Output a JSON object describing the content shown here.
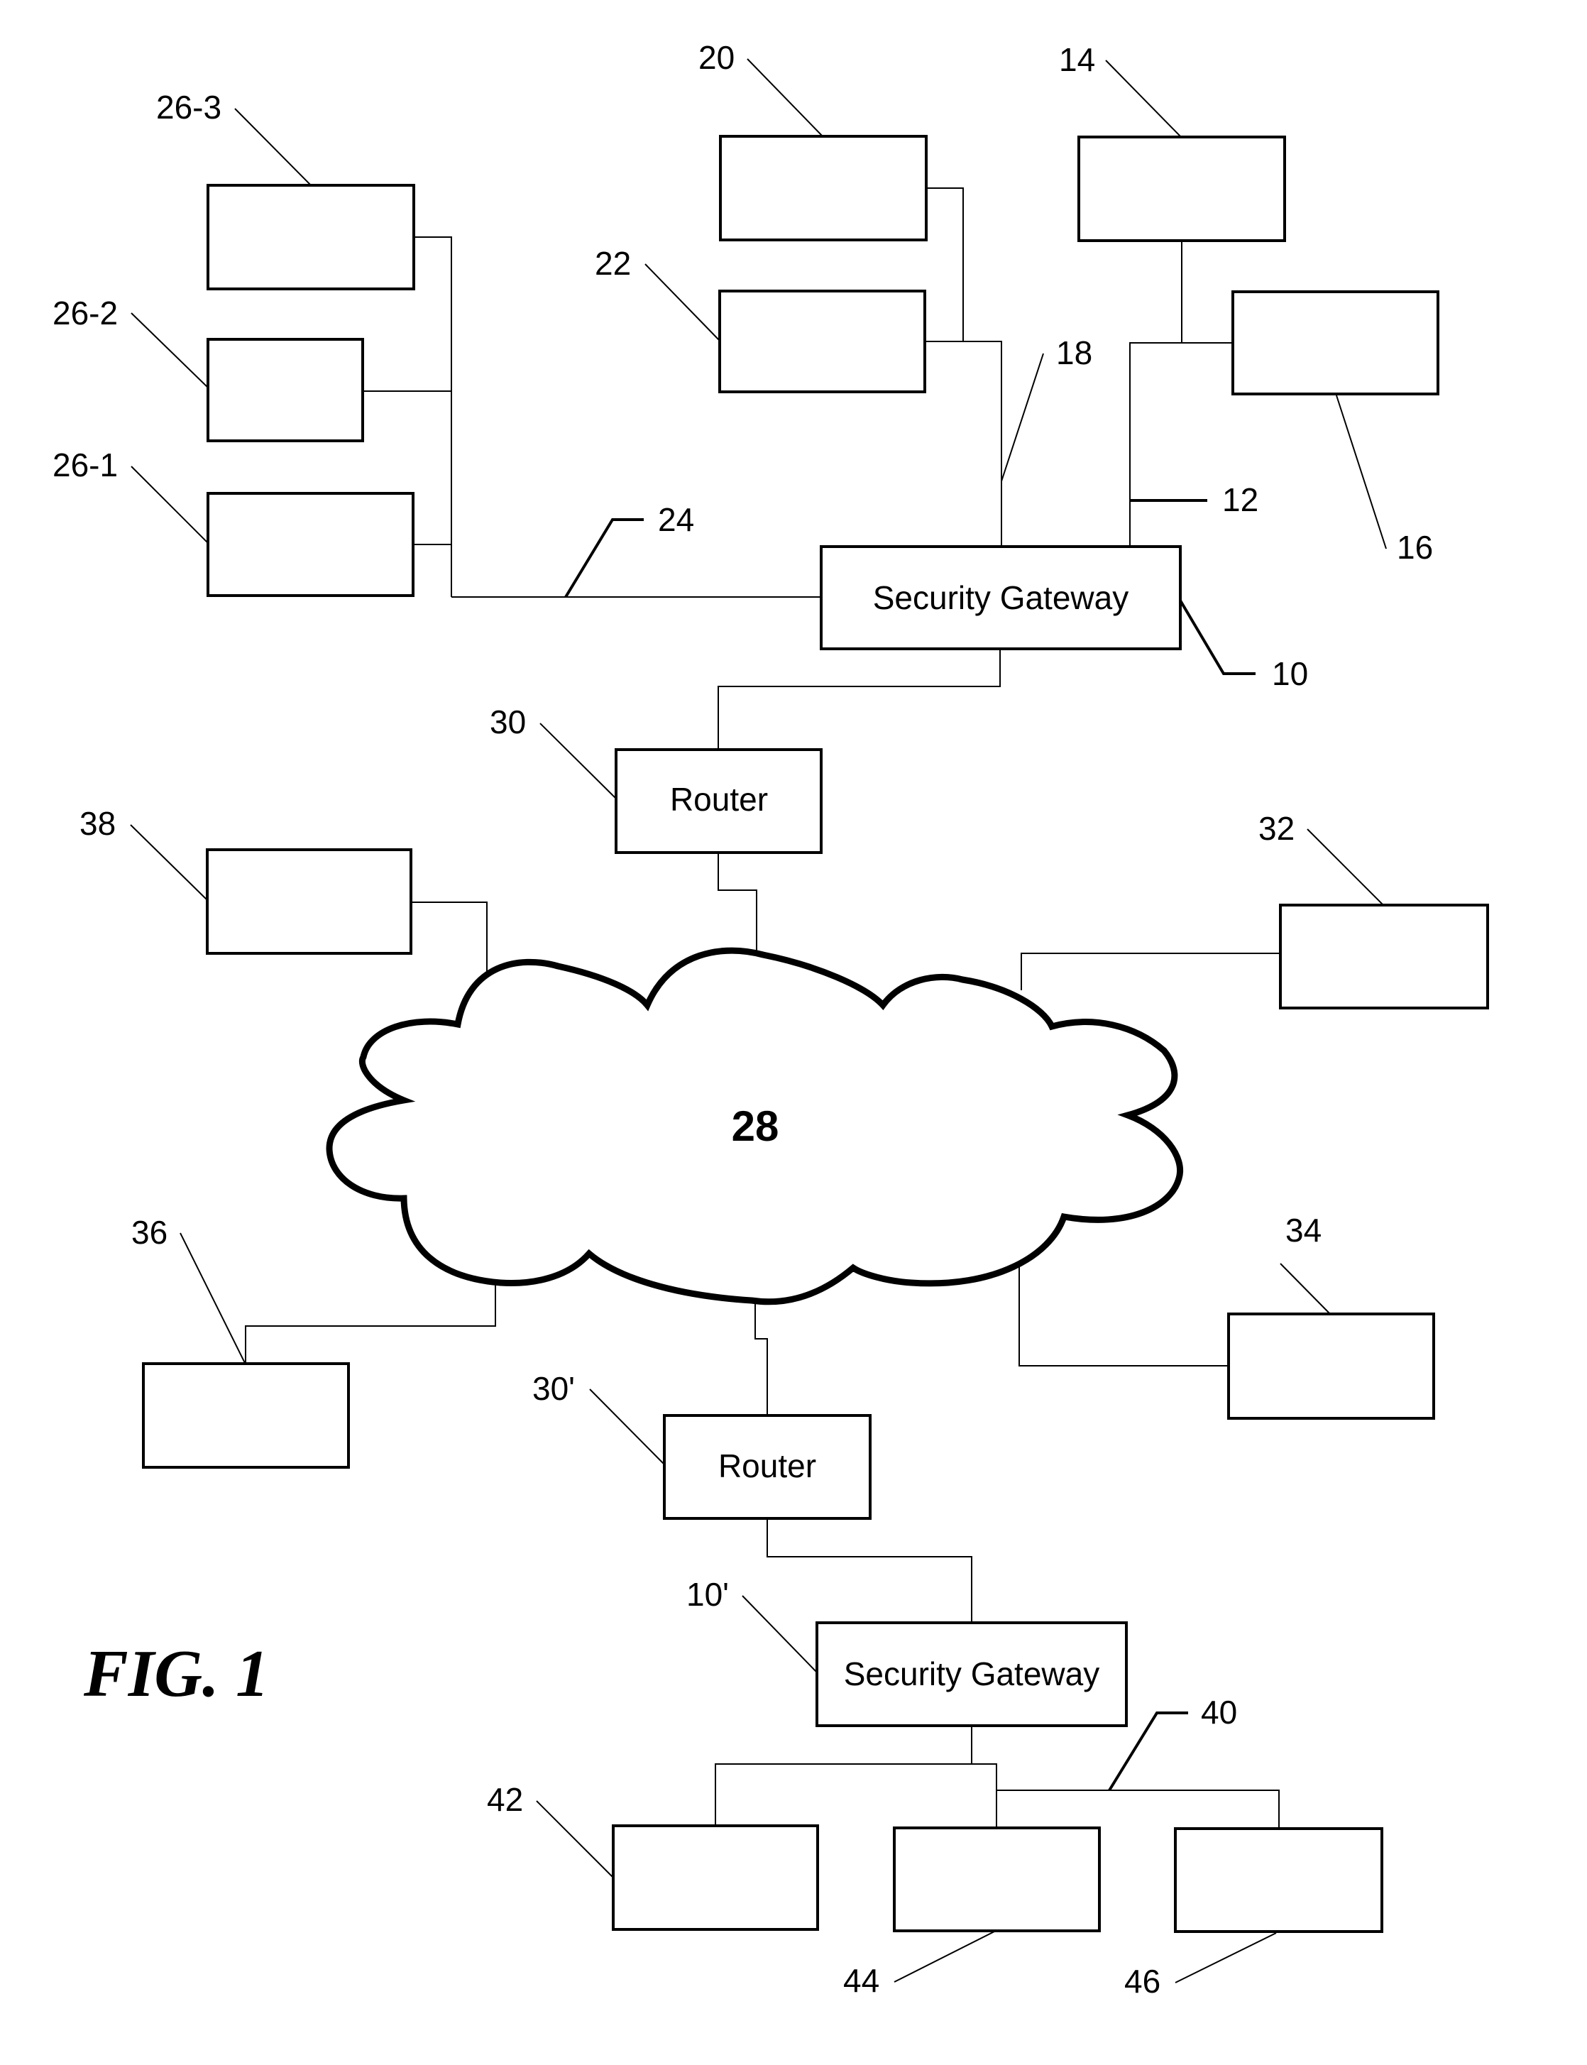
{
  "figure": {
    "caption": "FIG. 1",
    "cloud_label": "28"
  },
  "nodes": {
    "gateway_main": {
      "ref": "10",
      "label": "Security Gateway"
    },
    "gateway_remote": {
      "ref": "10'",
      "label": "Security Gateway"
    },
    "router_main": {
      "ref": "30",
      "label": "Router"
    },
    "router_remote": {
      "ref": "30'",
      "label": "Router"
    },
    "device_14": {
      "ref": "14",
      "label": ""
    },
    "device_16": {
      "ref": "16",
      "label": ""
    },
    "device_20": {
      "ref": "20",
      "label": ""
    },
    "device_22": {
      "ref": "22",
      "label": ""
    },
    "device_26_1": {
      "ref": "26-1",
      "label": ""
    },
    "device_26_2": {
      "ref": "26-2",
      "label": ""
    },
    "device_26_3": {
      "ref": "26-3",
      "label": ""
    },
    "device_32": {
      "ref": "32",
      "label": ""
    },
    "device_34": {
      "ref": "34",
      "label": ""
    },
    "device_36": {
      "ref": "36",
      "label": ""
    },
    "device_38": {
      "ref": "38",
      "label": ""
    },
    "device_42": {
      "ref": "42",
      "label": ""
    },
    "device_44": {
      "ref": "44",
      "label": ""
    },
    "device_46": {
      "ref": "46",
      "label": ""
    }
  },
  "networks": {
    "net_12": {
      "ref": "12"
    },
    "net_18": {
      "ref": "18"
    },
    "net_24": {
      "ref": "24"
    },
    "net_40": {
      "ref": "40"
    }
  }
}
